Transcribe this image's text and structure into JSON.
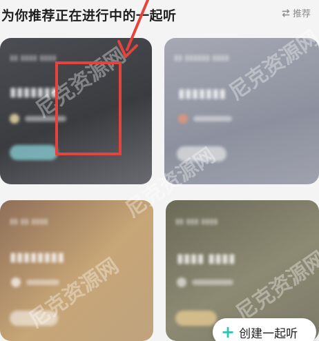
{
  "header": {
    "title": "为你推荐正在进行中的一起听",
    "refresh_label": "推荐"
  },
  "cards": [
    {
      "title": "",
      "subtitle": ""
    },
    {
      "title": "",
      "subtitle": ""
    },
    {
      "title": "",
      "subtitle": ""
    },
    {
      "title": "",
      "subtitle": ""
    }
  ],
  "watermark": "尼克资源网",
  "fab": {
    "label": "创建一起听",
    "icon": "plus-icon"
  },
  "colors": {
    "accent": "#2cc3b5",
    "annotation": "#e6433c"
  }
}
